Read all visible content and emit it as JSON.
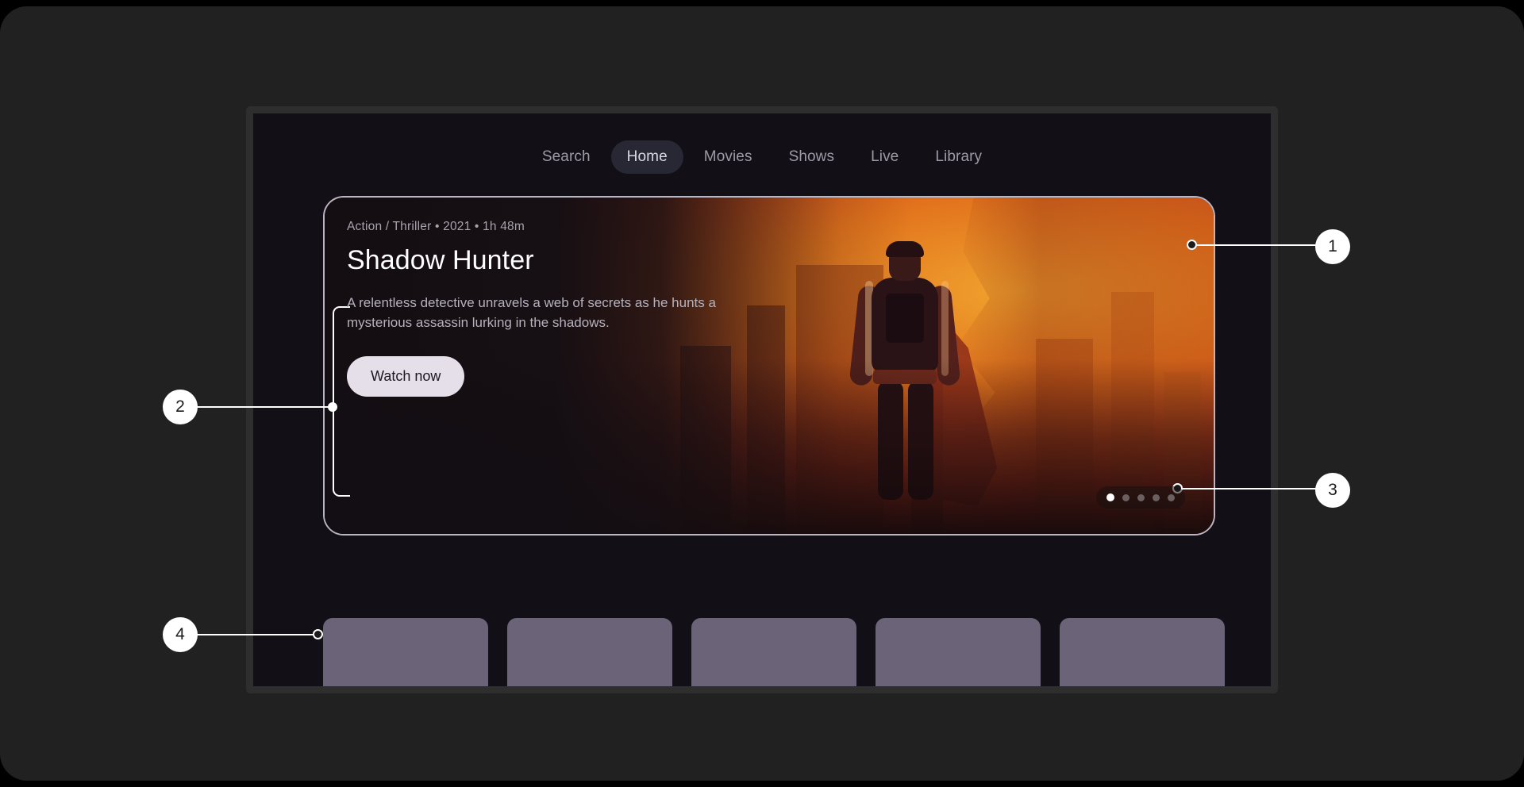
{
  "app": {
    "nav": {
      "items": [
        {
          "label": "Search",
          "active": false
        },
        {
          "label": "Home",
          "active": true
        },
        {
          "label": "Movies",
          "active": false
        },
        {
          "label": "Shows",
          "active": false
        },
        {
          "label": "Live",
          "active": false
        },
        {
          "label": "Library",
          "active": false
        }
      ]
    },
    "hero": {
      "meta": "Action / Thriller • 2021 • 1h 48m",
      "title": "Shadow Hunter",
      "description": "A relentless detective unravels a web of secrets as he hunts a mysterious assassin lurking in the shadows.",
      "cta_label": "Watch now",
      "carousel": {
        "total": 5,
        "active_index": 0
      }
    },
    "thumbnail_rail": {
      "count": 5
    }
  },
  "callouts": [
    {
      "number": "1",
      "target": "hero-card-border"
    },
    {
      "number": "2",
      "target": "hero-copy-block"
    },
    {
      "number": "3",
      "target": "carousel-dots"
    },
    {
      "number": "4",
      "target": "thumbnail-rail"
    }
  ],
  "colors": {
    "page_plate": "#212121",
    "device_bezel": "#2e2e2e",
    "screen_background": "#121016",
    "nav_active_pill": "#282834",
    "hero_border": "#b9b5c2",
    "cta_background": "#e4dfe9",
    "thumbnail": "#6b6478",
    "callout": "#ffffff"
  }
}
